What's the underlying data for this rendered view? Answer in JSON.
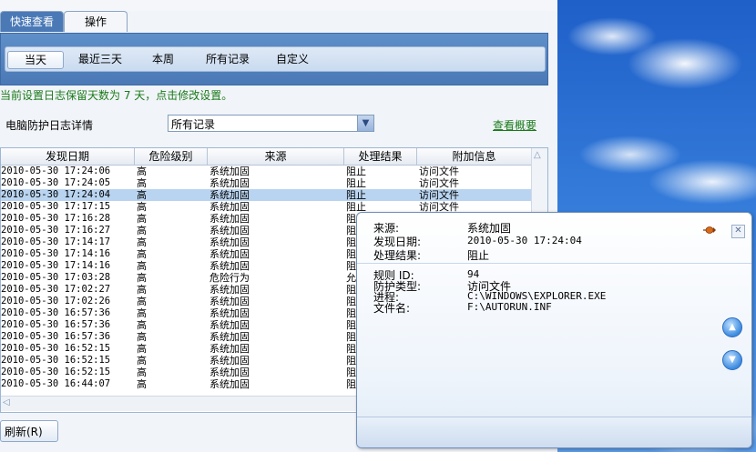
{
  "tabs": [
    {
      "label": "快速查看",
      "active": true
    },
    {
      "label": "操作",
      "active": false
    }
  ],
  "filters": [
    {
      "label": "当天",
      "active": true
    },
    {
      "label": "最近三天",
      "active": false
    },
    {
      "label": "本周",
      "active": false
    },
    {
      "label": "所有记录",
      "active": false
    },
    {
      "label": "自定义",
      "active": false
    }
  ],
  "retention_message": "当前设置日志保留天数为 7 天，点击修改设置。",
  "detail_label": "电脑防护日志详情",
  "record_select": {
    "value": "所有记录"
  },
  "overview_link": "查看概要",
  "table": {
    "columns": [
      "发现日期",
      "危险级别",
      "来源",
      "处理结果",
      "附加信息"
    ],
    "rows": [
      [
        "2010-05-30 17:24:06",
        "高",
        "系统加固",
        "阻止",
        "访问文件"
      ],
      [
        "2010-05-30 17:24:05",
        "高",
        "系统加固",
        "阻止",
        "访问文件"
      ],
      [
        "2010-05-30 17:24:04",
        "高",
        "系统加固",
        "阻止",
        "访问文件"
      ],
      [
        "2010-05-30 17:17:15",
        "高",
        "系统加固",
        "阻止",
        "访问文件"
      ],
      [
        "2010-05-30 17:16:28",
        "高",
        "系统加固",
        "阻",
        ""
      ],
      [
        "2010-05-30 17:16:27",
        "高",
        "系统加固",
        "阻",
        ""
      ],
      [
        "2010-05-30 17:14:17",
        "高",
        "系统加固",
        "阻",
        ""
      ],
      [
        "2010-05-30 17:14:16",
        "高",
        "系统加固",
        "阻",
        ""
      ],
      [
        "2010-05-30 17:14:16",
        "高",
        "系统加固",
        "阻",
        ""
      ],
      [
        "2010-05-30 17:03:28",
        "高",
        "危险行为",
        "允",
        ""
      ],
      [
        "2010-05-30 17:02:27",
        "高",
        "系统加固",
        "阻",
        ""
      ],
      [
        "2010-05-30 17:02:26",
        "高",
        "系统加固",
        "阻",
        ""
      ],
      [
        "2010-05-30 16:57:36",
        "高",
        "系统加固",
        "阻",
        ""
      ],
      [
        "2010-05-30 16:57:36",
        "高",
        "系统加固",
        "阻",
        ""
      ],
      [
        "2010-05-30 16:57:36",
        "高",
        "系统加固",
        "阻",
        ""
      ],
      [
        "2010-05-30 16:52:15",
        "高",
        "系统加固",
        "阻",
        ""
      ],
      [
        "2010-05-30 16:52:15",
        "高",
        "系统加固",
        "阻",
        ""
      ],
      [
        "2010-05-30 16:52:15",
        "高",
        "系统加固",
        "阻",
        ""
      ],
      [
        "2010-05-30 16:44:07",
        "高",
        "系统加固",
        "阻",
        ""
      ]
    ],
    "selected_row": 2
  },
  "refresh_button": "刷新(R)",
  "popup": {
    "source_label": "来源:",
    "source_value": "系统加固",
    "date_label": "发现日期:",
    "date_value": "2010-05-30 17:24:04",
    "result_label": "处理结果:",
    "result_value": "阻止",
    "rule_label": "规则 ID:",
    "rule_value": "94",
    "type_label": "防护类型:",
    "type_value": "访问文件",
    "process_label": "进程:",
    "process_value": "C:\\WINDOWS\\EXPLORER.EXE",
    "file_label": "文件名:",
    "file_value": "F:\\AUTORUN.INF"
  },
  "colors": {
    "accent_blue": "#4a79b6",
    "link_green": "#1a7a1a",
    "selected_row": "#b9d4f0"
  },
  "icons": [
    "close-icon",
    "pin-icon",
    "scroll-up-icon",
    "scroll-down-icon",
    "dropdown-arrow-icon"
  ]
}
